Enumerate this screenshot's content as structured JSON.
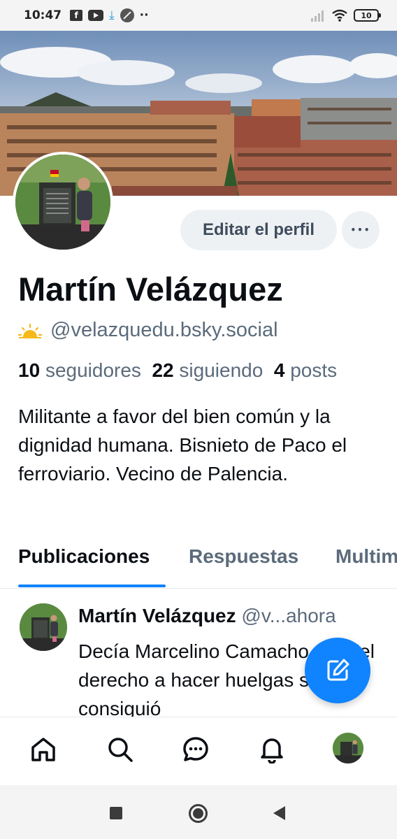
{
  "status_bar": {
    "time": "10:47",
    "battery": "10",
    "icons": [
      "facebook-icon",
      "youtube-icon",
      "download-icon",
      "blocked-icon",
      "more-dots-icon",
      "signal-icon",
      "wifi-icon",
      "battery-icon"
    ]
  },
  "profile": {
    "edit_button": "Editar el perfil",
    "more_button": "•••",
    "display_name": "Martín Velázquez",
    "handle": "@velazquedu.bsky.social",
    "followers_count": "10",
    "followers_label": "seguidores",
    "following_count": "22",
    "following_label": "siguiendo",
    "posts_count": "4",
    "posts_label": "posts",
    "bio": "Militante a favor del bien común y la dignidad humana. Bisnieto de Paco el ferroviario. Vecino de Palencia."
  },
  "tabs": [
    {
      "label": "Publicaciones",
      "active": true
    },
    {
      "label": "Respuestas",
      "active": false
    },
    {
      "label": "Multimedia",
      "active": false
    }
  ],
  "post": {
    "author": "Martín Velázquez",
    "handle": "@v...",
    "time": "ahora",
    "text": "Decía Marcelino Camacho que \"el derecho a hacer huelgas se consiguió"
  },
  "bottom_nav": [
    "home-icon",
    "search-icon",
    "chat-icon",
    "bell-icon",
    "profile-avatar"
  ],
  "colors": {
    "accent": "#1083fe",
    "muted_text": "#5b6b7b",
    "button_bg": "#eef1f4"
  }
}
